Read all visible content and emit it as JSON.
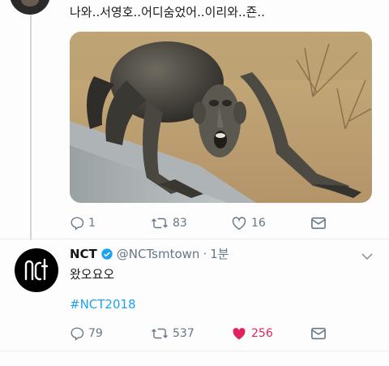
{
  "reply_tweet": {
    "text": "나와..서영호..어디숨었어..이리와..죤..",
    "stats": {
      "replies": "1",
      "retweets": "83",
      "likes": "16"
    }
  },
  "main_tweet": {
    "avatar_text": "NCT",
    "name": "NCT",
    "handle": "@NCTsmtown",
    "separator": "·",
    "time": "1분",
    "text": "왔오요오",
    "hashtag": "#NCT2018",
    "stats": {
      "replies": "79",
      "retweets": "537",
      "likes": "256"
    }
  },
  "colors": {
    "accent": "#1da1f2",
    "like": "#e0245e",
    "muted": "#657786",
    "thread": "#ccd6dd"
  },
  "icons": [
    "reply-icon",
    "retweet-icon",
    "like-icon",
    "share-icon",
    "verified-icon",
    "chevron-down-icon"
  ]
}
